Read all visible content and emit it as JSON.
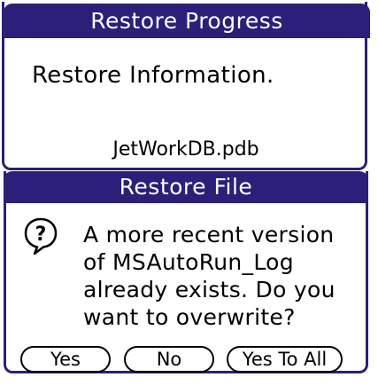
{
  "restore_progress": {
    "title": "Restore Progress",
    "info_text": "Restore Information.",
    "file_name": "JetWorkDB.pdb"
  },
  "restore_file": {
    "title": "Restore File",
    "icon": "question-icon",
    "message": "A more recent version\nof MSAutoRun_Log\nalready exists. Do you\nwant to overwrite?",
    "buttons": {
      "yes": "Yes",
      "no": "No",
      "yes_to_all": "Yes To All"
    }
  },
  "colors": {
    "title_bar": "#2b1f7a",
    "title_text": "#ffffff",
    "background": "#ffffff",
    "text": "#000000"
  }
}
